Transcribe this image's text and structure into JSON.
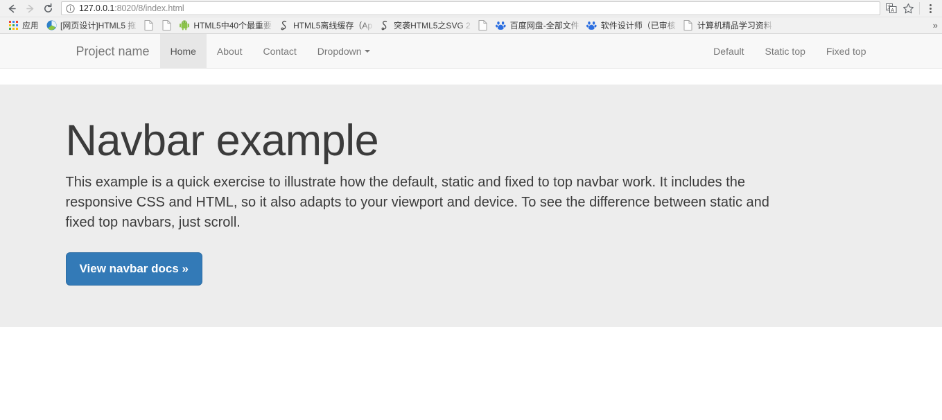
{
  "browser": {
    "back_label": "Back",
    "forward_label": "Forward",
    "reload_label": "Reload",
    "url_host": "127.0.0.1",
    "url_rest": ":8020/8/index.html",
    "url_full": "127.0.0.1:8020/8/index.html",
    "site_info_icon": "info-circle-icon",
    "translate_icon": "translate-icon",
    "bookmark_star_icon": "star-icon",
    "menu_icon": "three-dot-menu-icon",
    "bookmarks": [
      {
        "label": "应用",
        "icon": "apps-grid-icon"
      },
      {
        "label": "[网页设计]HTML5 拖",
        "icon": "colored-site-icon"
      },
      {
        "label": "",
        "icon": "page-icon"
      },
      {
        "label": "",
        "icon": "page-icon"
      },
      {
        "label": "HTML5中40个最重要",
        "icon": "android-icon"
      },
      {
        "label": "HTML5离线缓存（Ap",
        "icon": "anchor-icon"
      },
      {
        "label": "突袭HTML5之SVG 2",
        "icon": "anchor-icon"
      },
      {
        "label": "",
        "icon": "page-icon"
      },
      {
        "label": "百度网盘-全部文件",
        "icon": "baidu-icon"
      },
      {
        "label": "软件设计师（已审核",
        "icon": "baidu-icon"
      },
      {
        "label": "计算机精品学习资料",
        "icon": "page-icon"
      }
    ],
    "overflow_label": "»"
  },
  "navbar": {
    "brand": "Project name",
    "left_items": [
      {
        "label": "Home",
        "active": true,
        "caret": false
      },
      {
        "label": "About",
        "active": false,
        "caret": false
      },
      {
        "label": "Contact",
        "active": false,
        "caret": false
      },
      {
        "label": "Dropdown",
        "active": false,
        "caret": true
      }
    ],
    "right_items": [
      {
        "label": "Default"
      },
      {
        "label": "Static top"
      },
      {
        "label": "Fixed top"
      }
    ]
  },
  "jumbotron": {
    "title": "Navbar example",
    "paragraph": "This example is a quick exercise to illustrate how the default, static and fixed to top navbar work. It includes the responsive CSS and HTML, so it also adapts to your viewport and device. To see the difference between static and fixed top navbars, just scroll.",
    "button_label": "View navbar docs »"
  },
  "colors": {
    "navbar_bg": "#f8f8f8",
    "navbar_active_bg": "#e7e7e7",
    "jumbotron_bg": "#ededed",
    "button_bg": "#337ab7",
    "button_border": "#2e6da4",
    "text_muted": "#777777",
    "heading": "#3b3b3b"
  }
}
